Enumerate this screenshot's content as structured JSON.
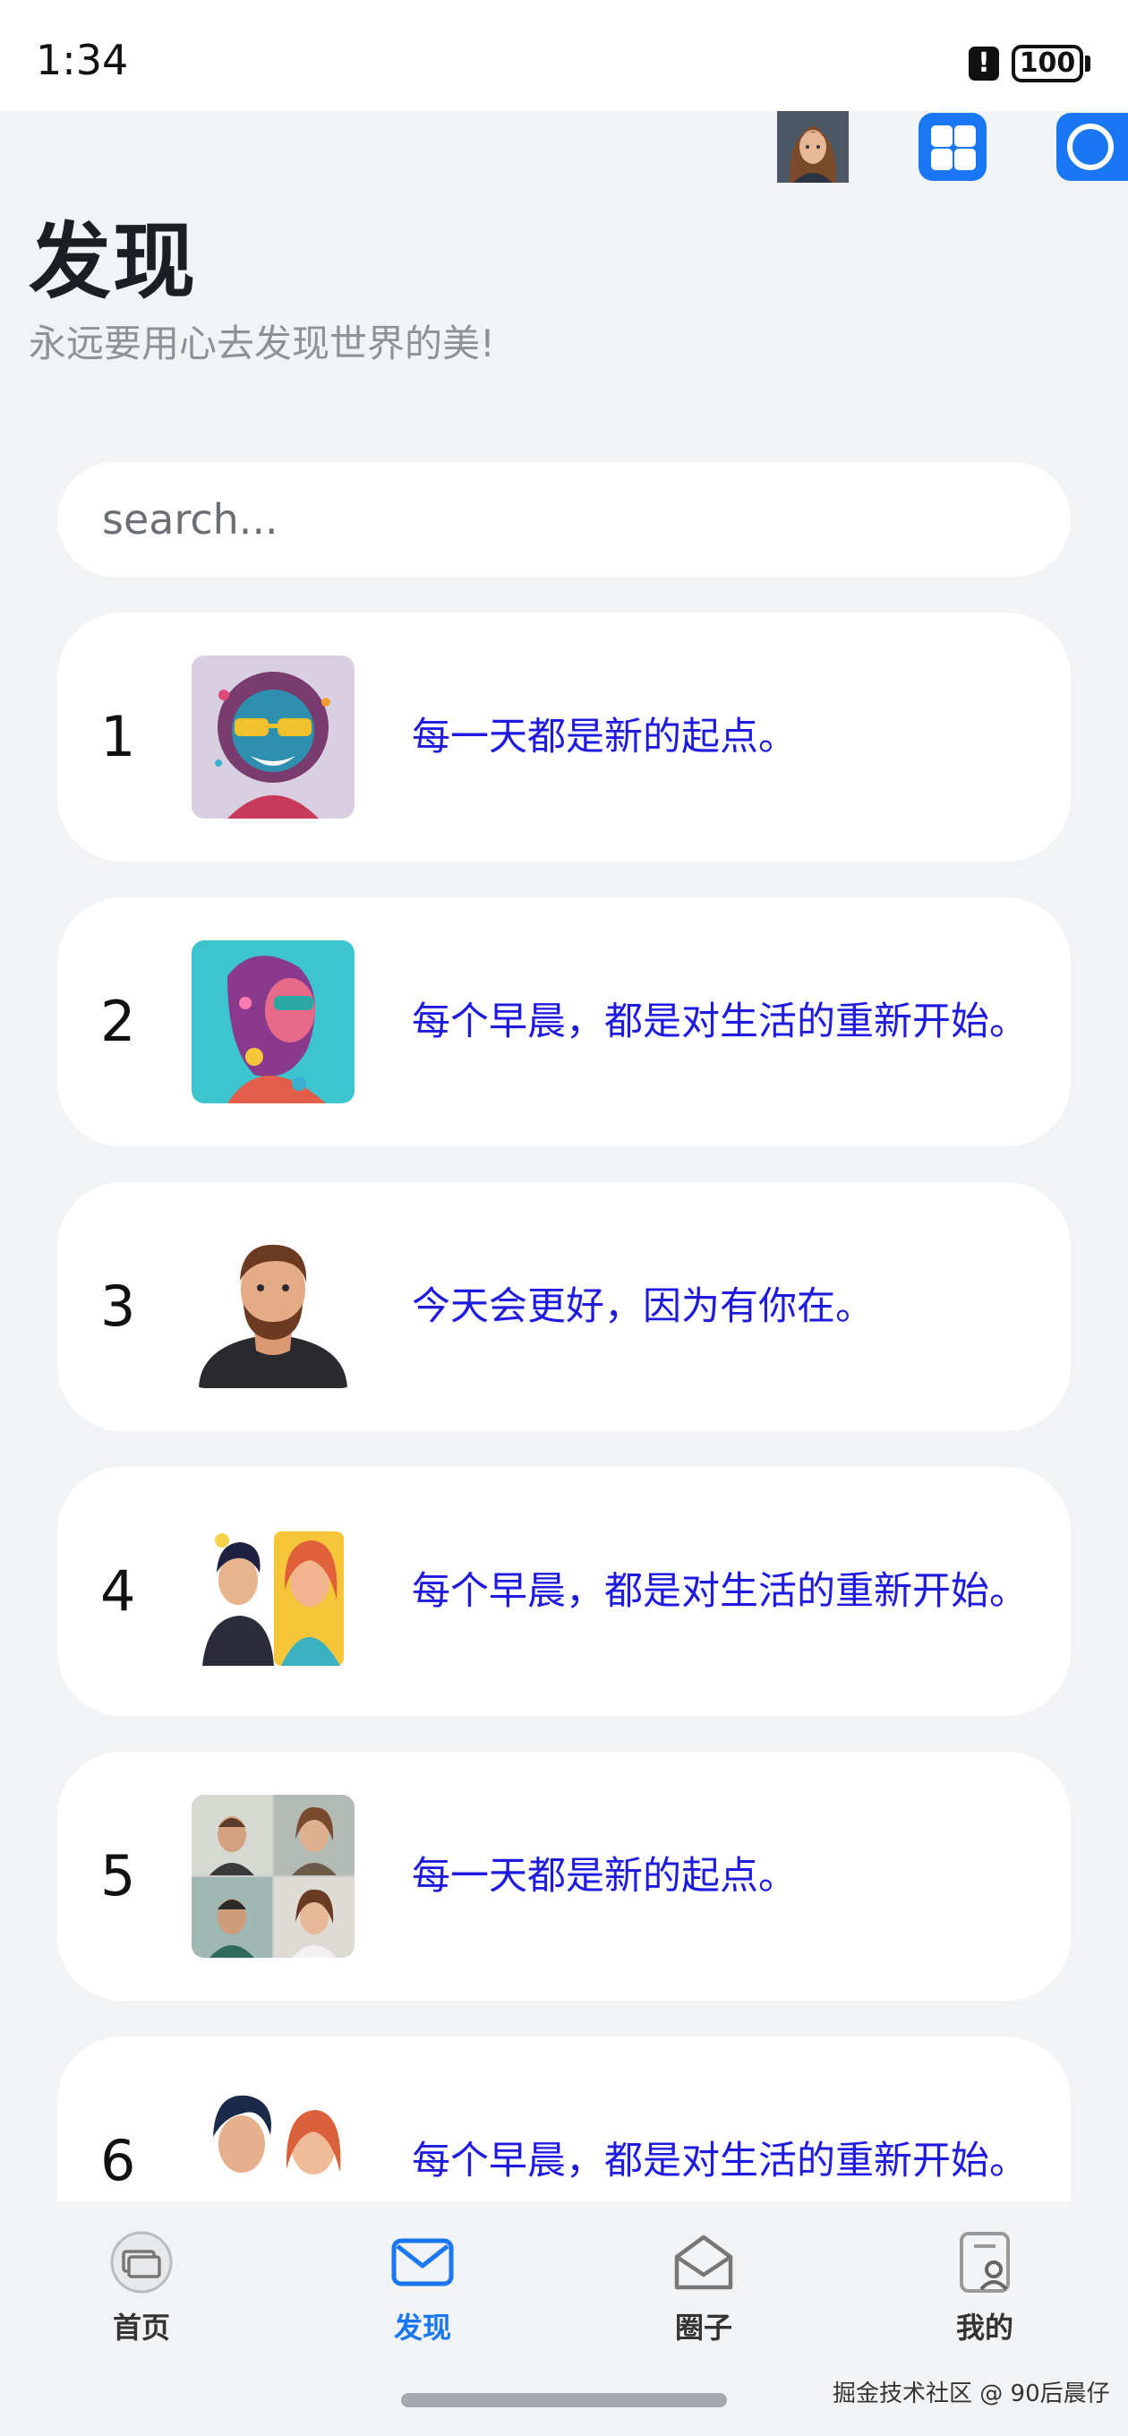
{
  "status": {
    "time": "1:34",
    "alert": "!",
    "battery": "100"
  },
  "header": {
    "title": "发现",
    "subtitle": "永远要用心去发现世界的美!"
  },
  "top_icons": [
    "avatar-image",
    "grid-icon",
    "circle-icon"
  ],
  "search": {
    "placeholder": "search..."
  },
  "list": [
    {
      "num": "1",
      "text": "每一天都是新的起点。",
      "image": "colorful-face-glasses-avatar"
    },
    {
      "num": "2",
      "text": "每个早晨，都是对生活的重新开始。",
      "image": "colorful-portrait-avatar"
    },
    {
      "num": "3",
      "text": "今天会更好，因为有你在。",
      "image": "bearded-man-avatar"
    },
    {
      "num": "4",
      "text": "每个早晨，都是对生活的重新开始。",
      "image": "couple-cartoon-avatar"
    },
    {
      "num": "5",
      "text": "每一天都是新的起点。",
      "image": "four-avatars-grid"
    },
    {
      "num": "6",
      "text": "每个早晨，都是对生活的重新开始。",
      "image": "couple-avatar"
    }
  ],
  "nav": [
    {
      "label": "首页",
      "icon": "home-tv-icon",
      "active": false
    },
    {
      "label": "发现",
      "icon": "mail-icon",
      "active": true
    },
    {
      "label": "圈子",
      "icon": "open-envelope-icon",
      "active": false
    },
    {
      "label": "我的",
      "icon": "profile-card-icon",
      "active": false
    }
  ],
  "watermark": "掘金技术社区 @ 90后晨仔",
  "colors": {
    "accent": "#1977f3",
    "link_text": "#1f1ae0",
    "background": "#f1f3f5"
  }
}
